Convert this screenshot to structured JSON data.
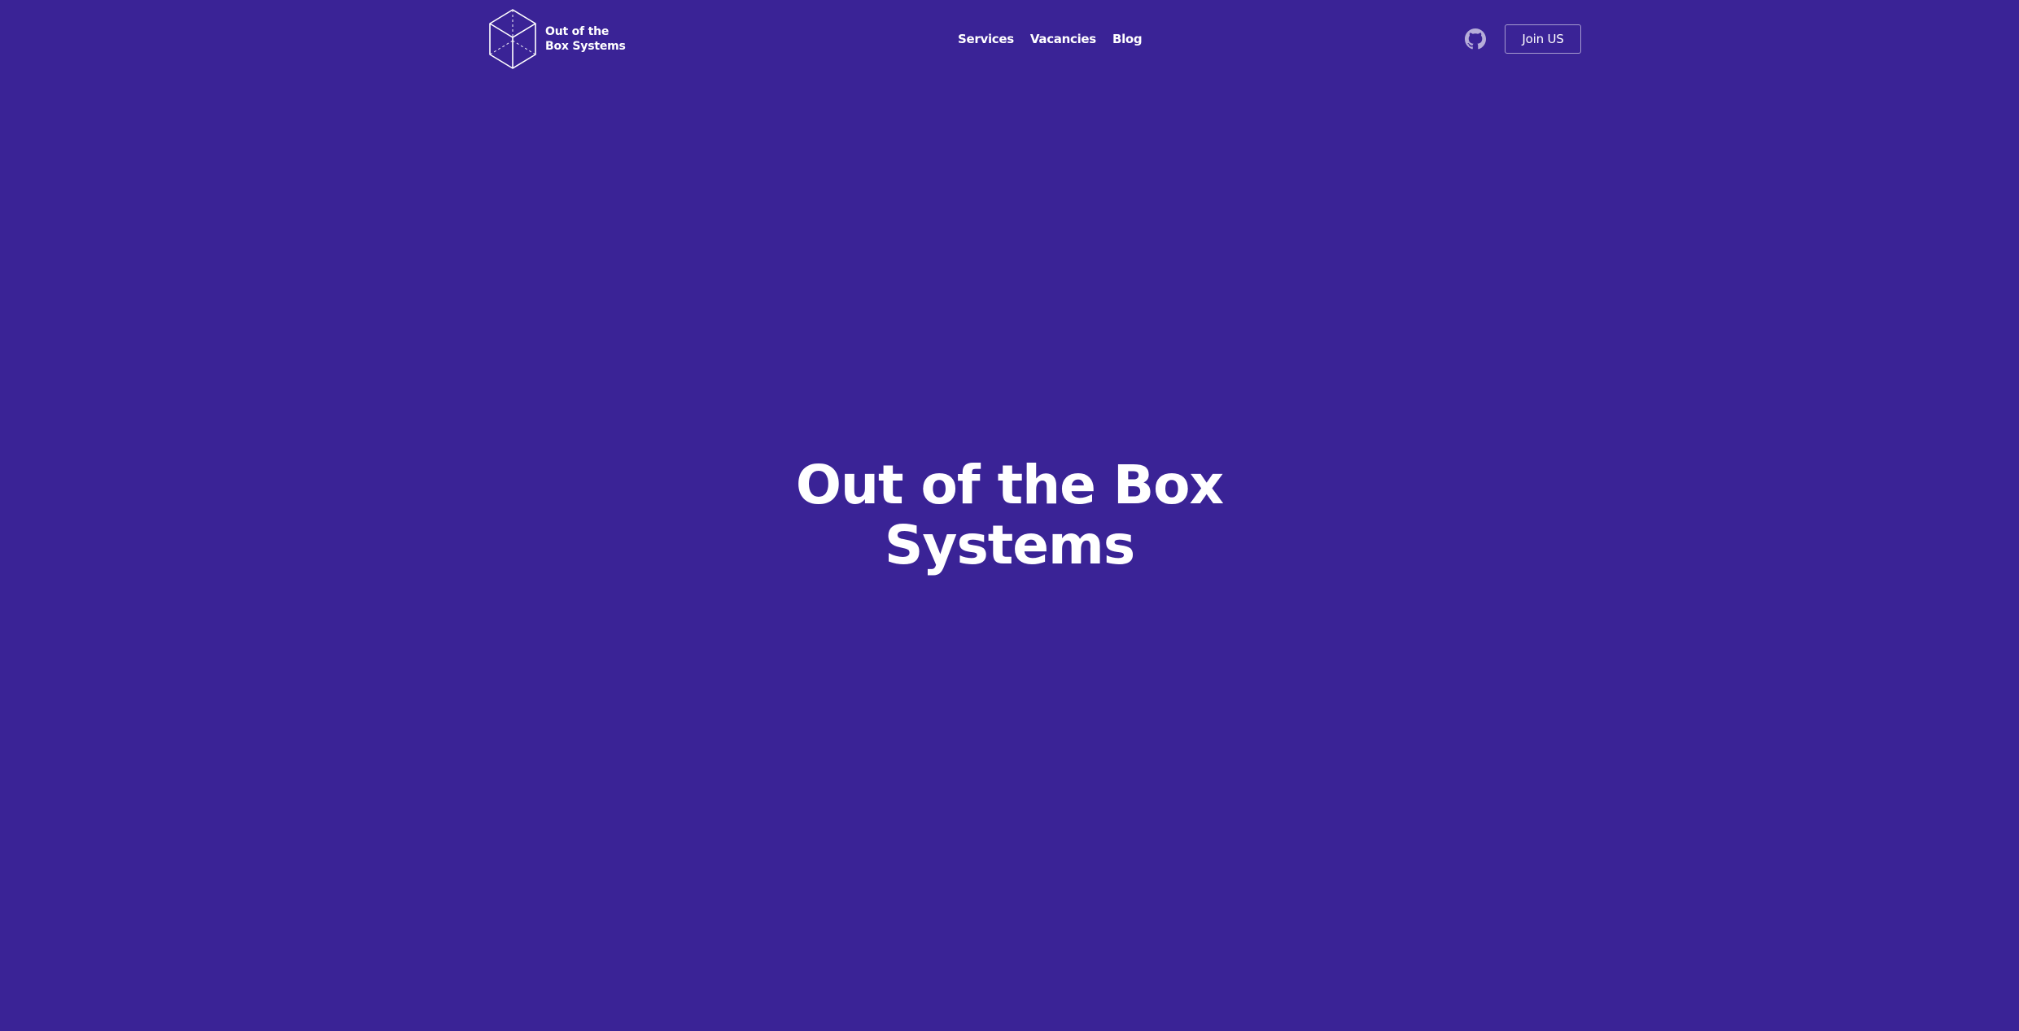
{
  "brand": {
    "line1": "Out of the",
    "line2": "Box Systems",
    "logo_icon": "cube-icon"
  },
  "nav": {
    "items": [
      {
        "label": "Services"
      },
      {
        "label": "Vacancies"
      },
      {
        "label": "Blog"
      }
    ]
  },
  "header_actions": {
    "github_icon": "github-icon",
    "join_label": "Join US"
  },
  "hero": {
    "title_line1": "Out of the Box",
    "title_line2": "Systems"
  },
  "colors": {
    "background": "#3a2396",
    "text": "#ffffff",
    "icon_muted": "#b6add9"
  }
}
